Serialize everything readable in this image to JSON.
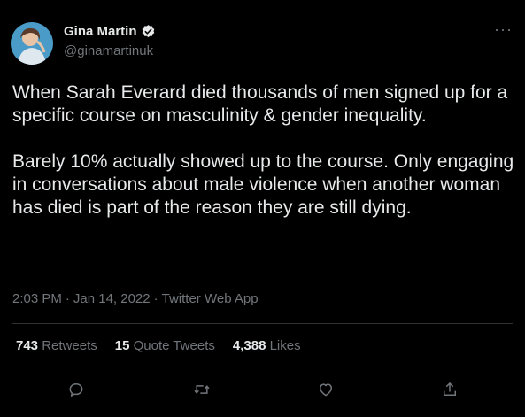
{
  "author": {
    "name": "Gina Martin",
    "handle": "@ginamartinuk",
    "verified": true
  },
  "tweet": {
    "text": "When Sarah Everard died thousands of men signed up for a specific course on masculinity & gender inequality.\n\nBarely 10% actually showed up to the course. Only engaging in conversations about male violence when another woman has died is part of the reason they are still dying."
  },
  "meta": {
    "time": "2:03 PM",
    "date": "Jan 14, 2022",
    "client": "Twitter Web App"
  },
  "stats": {
    "retweets": "743",
    "retweets_label": "Retweets",
    "quotes": "15",
    "quotes_label": "Quote Tweets",
    "likes": "4,388",
    "likes_label": "Likes"
  },
  "actions": [
    "reply-icon",
    "retweet-icon",
    "like-icon",
    "share-icon"
  ],
  "colors": {
    "background": "#000000",
    "text": "#e7e9ea",
    "muted": "#71767b",
    "divider": "#2f3336"
  }
}
